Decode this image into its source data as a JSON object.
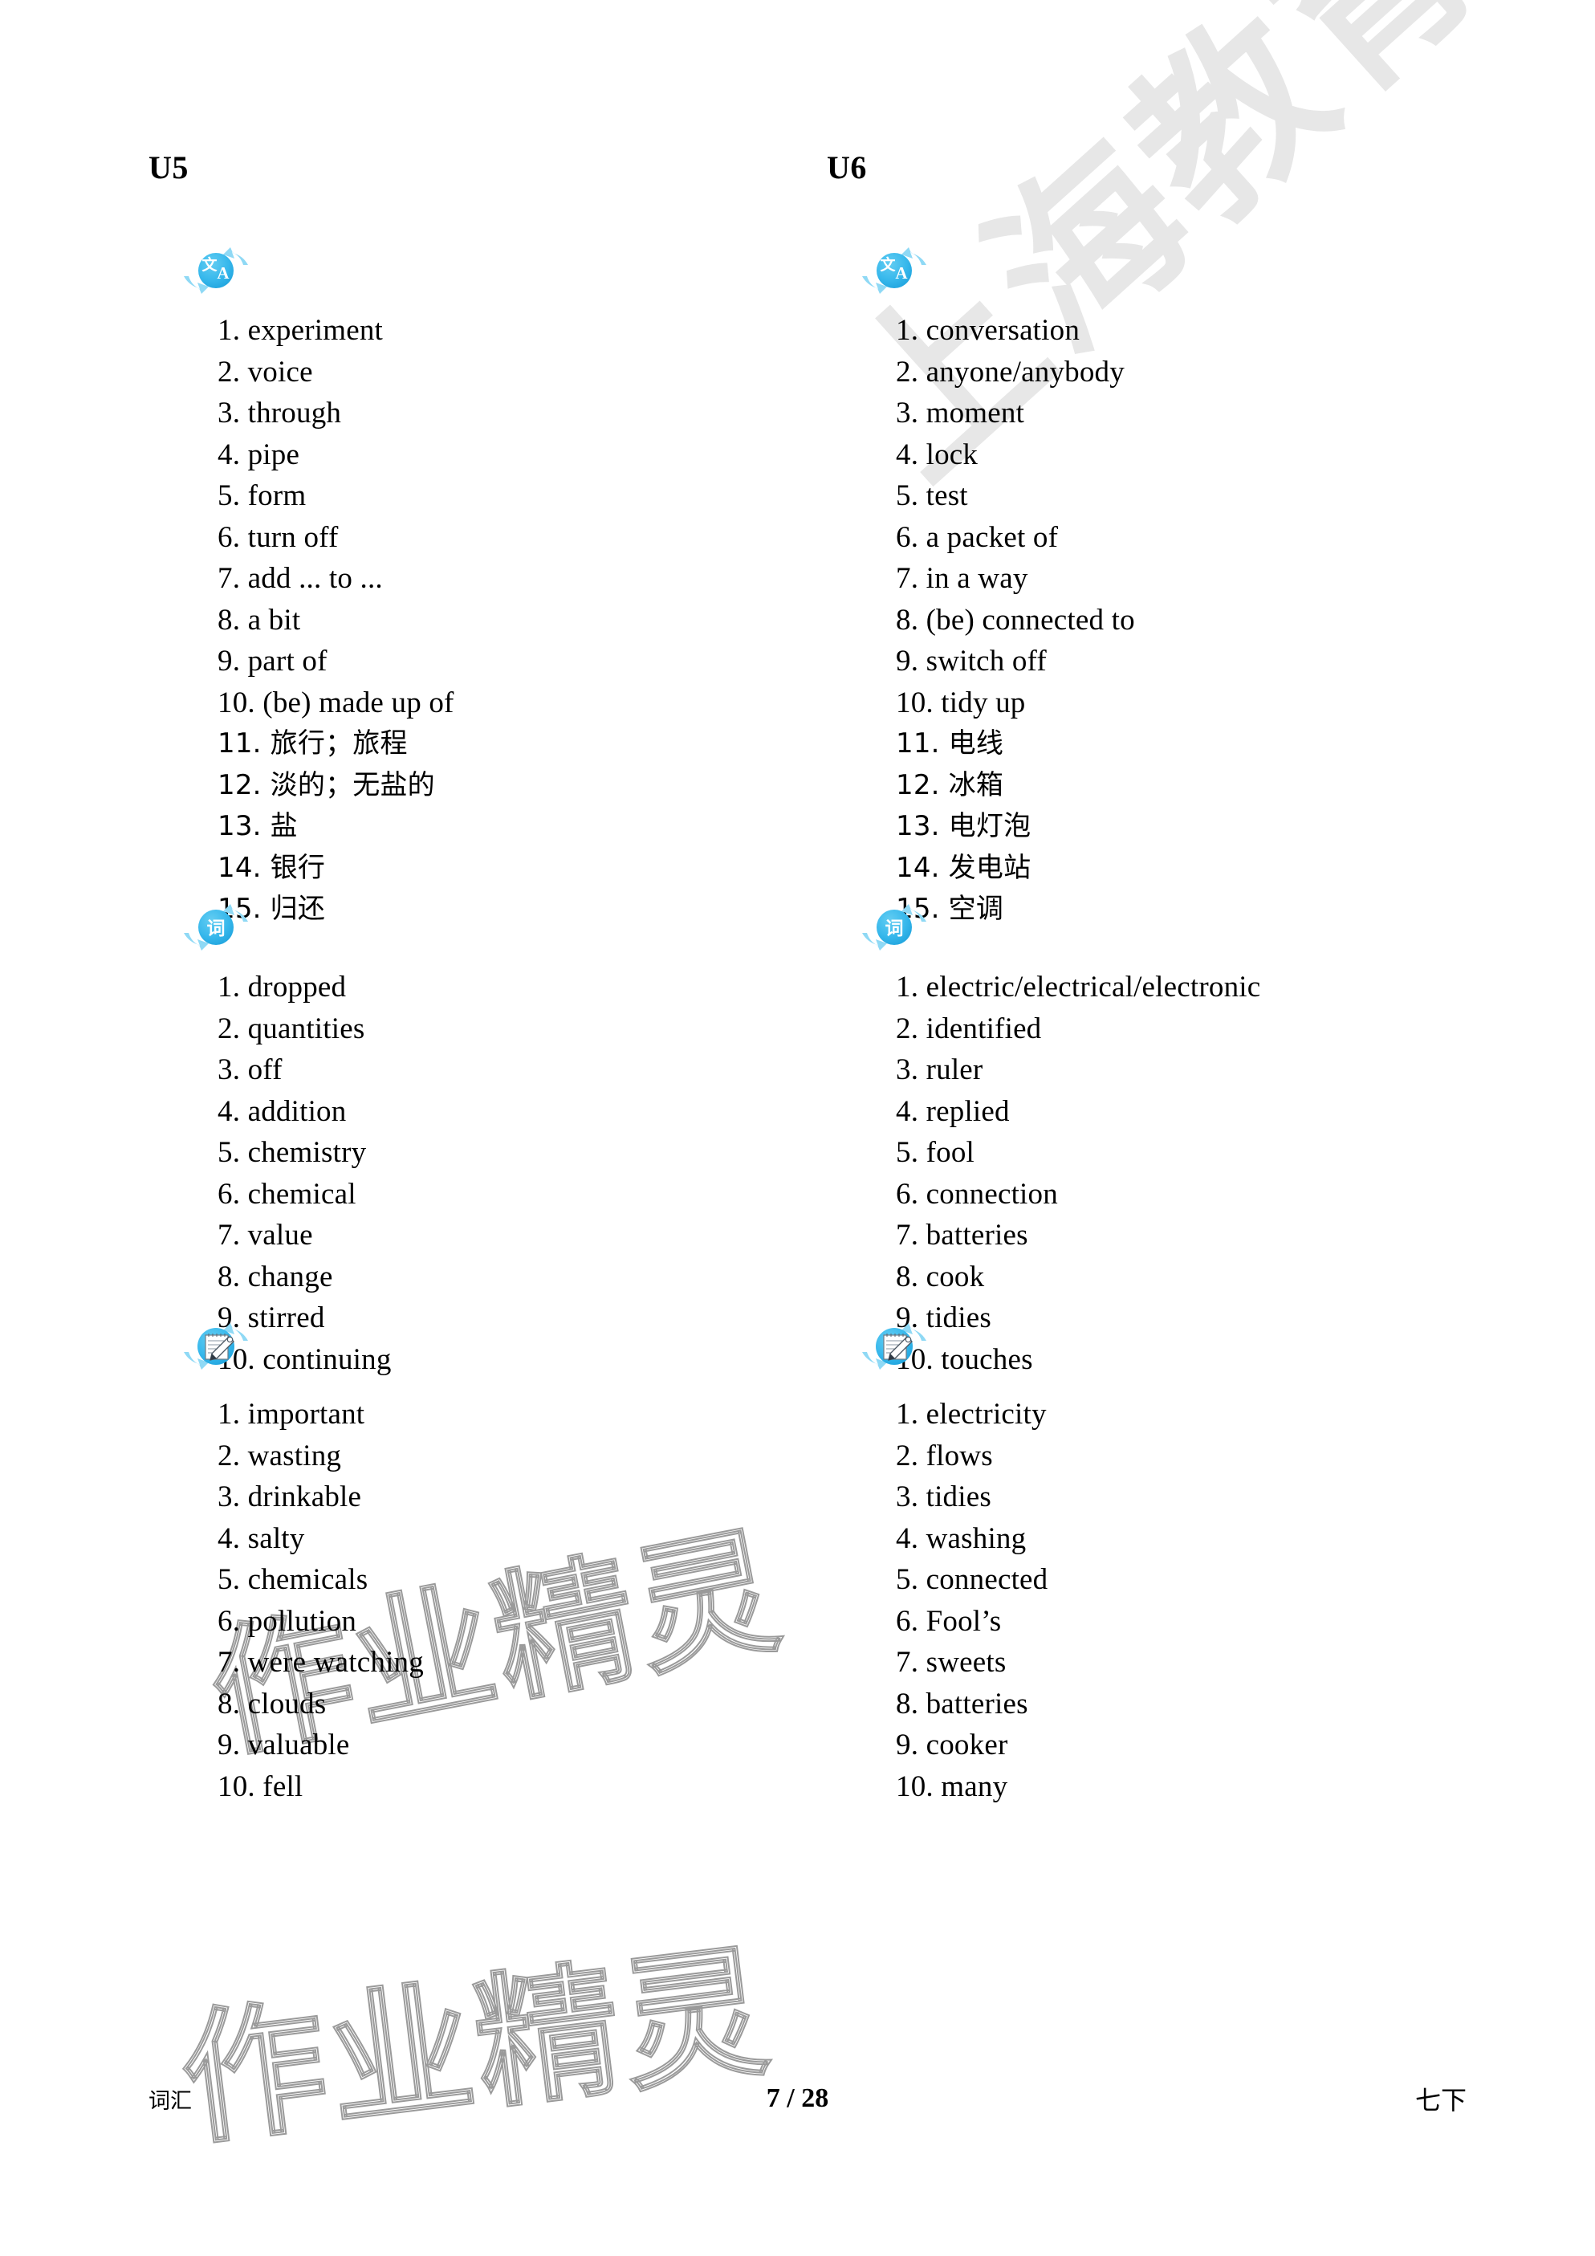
{
  "document": {
    "watermarks": {
      "diagonal": "上海教育出版社",
      "outline_middle": "作业精灵",
      "outline_bottom": "作业精灵"
    }
  },
  "columns": [
    {
      "unit_label": "U5",
      "sections": [
        {
          "icon": "translate-icon",
          "icon_glyphs": {
            "cjk": "文",
            "latin": "A"
          },
          "items": [
            "1. experiment",
            "2. voice",
            "3. through",
            "4. pipe",
            "5. form",
            "6. turn off",
            "7. add ... to ...",
            "8. a bit",
            "9. part of",
            "10. (be) made up of",
            "11. 旅行；旅程",
            "12. 淡的；无盐的",
            "13. 盐",
            "14. 银行",
            "15. 归还"
          ]
        },
        {
          "icon": "word-icon",
          "icon_glyphs": {
            "cjk": "词"
          },
          "items": [
            "1. dropped",
            "2. quantities",
            "3. off",
            "4. addition",
            "5. chemistry",
            "6. chemical",
            "7. value",
            "8. change",
            "9. stirred",
            "10. continuing"
          ]
        },
        {
          "icon": "notepad-pencil-icon",
          "icon_glyphs": {},
          "items": [
            "1. important",
            "2. wasting",
            "3. drinkable",
            "4. salty",
            "5. chemicals",
            "6. pollution",
            "7. were watching",
            "8. clouds",
            "9. valuable",
            "10. fell"
          ]
        }
      ]
    },
    {
      "unit_label": "U6",
      "sections": [
        {
          "icon": "translate-icon",
          "icon_glyphs": {
            "cjk": "文",
            "latin": "A"
          },
          "items": [
            "1. conversation",
            "2. anyone/anybody",
            "3. moment",
            "4. lock",
            "5. test",
            "6. a packet of",
            "7. in a way",
            "8. (be) connected to",
            "9. switch off",
            "10. tidy up",
            "11. 电线",
            "12. 冰箱",
            "13. 电灯泡",
            "14. 发电站",
            "15. 空调"
          ]
        },
        {
          "icon": "word-icon",
          "icon_glyphs": {
            "cjk": "词"
          },
          "items": [
            "1. electric/electrical/electronic",
            "2. identified",
            "3. ruler",
            "4. replied",
            "5. fool",
            "6. connection",
            "7. batteries",
            "8. cook",
            "9. tidies",
            "10. touches"
          ]
        },
        {
          "icon": "notepad-pencil-icon",
          "icon_glyphs": {},
          "items": [
            "1. electricity",
            "2. flows",
            "3. tidies",
            "4. washing",
            "5. connected",
            "6. Fool’s",
            "7. sweets",
            "8. batteries",
            "9. cooker",
            "10. many"
          ]
        }
      ]
    }
  ],
  "footer": {
    "left_label": "词汇",
    "page_indicator": "7 / 28",
    "right_label": "七下"
  },
  "colors": {
    "icon_blue": "#35b5ea",
    "icon_blue_light": "#8fd9f5",
    "watermark_gray": "#e7e7e7",
    "watermark_outline": "#9a9a9a"
  }
}
